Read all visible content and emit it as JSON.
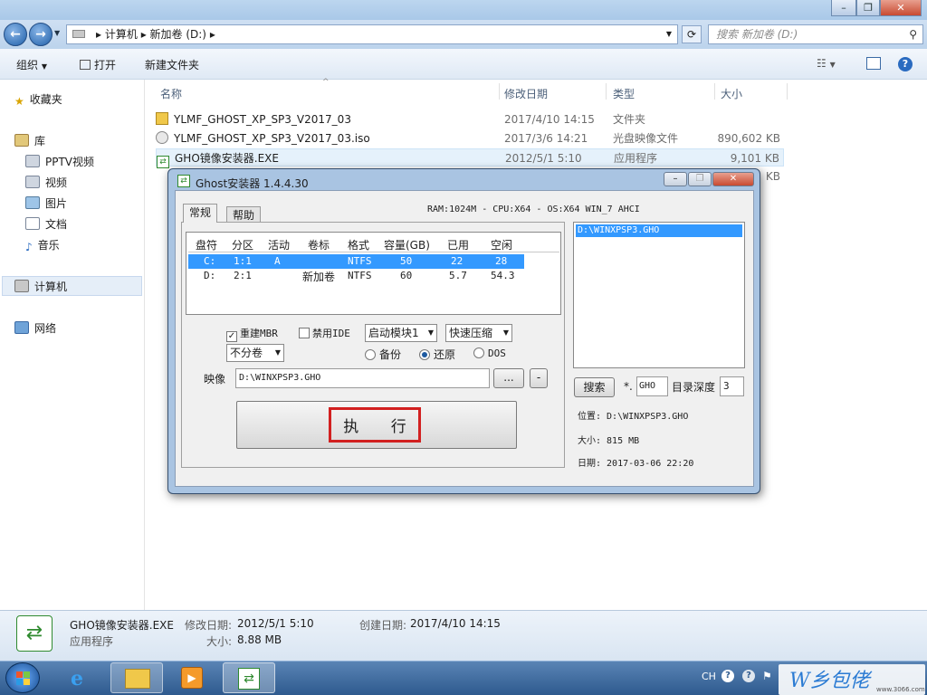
{
  "explorer": {
    "breadcrumb": [
      "计算机",
      "新加卷 (D:)"
    ],
    "search_placeholder": "搜索 新加卷 (D:)",
    "toolbar": {
      "organize": "组织",
      "open": "打开",
      "new_folder": "新建文件夹"
    },
    "nav": {
      "favorites": "收藏夹",
      "libraries": "库",
      "lib_items": [
        "PPTV视频",
        "视频",
        "图片",
        "文档",
        "音乐"
      ],
      "computer": "计算机",
      "network": "网络"
    },
    "columns": [
      "名称",
      "修改日期",
      "类型",
      "大小"
    ],
    "files": [
      {
        "name": "YLMF_GHOST_XP_SP3_V2017_03",
        "date": "2017/4/10 14:15",
        "type": "文件夹",
        "size": ""
      },
      {
        "name": "YLMF_GHOST_XP_SP3_V2017_03.iso",
        "date": "2017/3/6 14:21",
        "type": "光盘映像文件",
        "size": "890,602 KB"
      },
      {
        "name": "GHO镜像安装器.EXE",
        "date": "2012/5/1 5:10",
        "type": "应用程序",
        "size": "9,101 KB"
      },
      {
        "name": "",
        "date": "",
        "type": "",
        "size": "KB"
      }
    ],
    "details": {
      "name": "GHO镜像安装器.EXE",
      "modified_label": "修改日期:",
      "modified": "2012/5/1 5:10",
      "created_label": "创建日期:",
      "created": "2017/4/10 14:15",
      "kind": "应用程序",
      "size_label": "大小:",
      "size": "8.88 MB"
    }
  },
  "dialog": {
    "title": "Ghost安装器 1.4.4.30",
    "sysinfo": "RAM:1024M - CPU:X64 - OS:X64 WIN_7 AHCI",
    "tabs": [
      "常规",
      "帮助"
    ],
    "grid_headers": [
      "盘符",
      "分区",
      "活动",
      "卷标",
      "格式",
      "容量(GB)",
      "已用",
      "空闲"
    ],
    "grid_rows": [
      [
        "C:",
        "1:1",
        "A",
        "",
        "NTFS",
        "50",
        "22",
        "28"
      ],
      [
        "D:",
        "2:1",
        "",
        "新加卷",
        "NTFS",
        "60",
        "5.7",
        "54.3"
      ]
    ],
    "opt_rebuild_mbr": "重建MBR",
    "opt_disable_ide": "禁用IDE",
    "boot_module": "启动模块1",
    "compress": "快速压缩",
    "split": "不分卷",
    "radio_backup": "备份",
    "radio_restore": "还原",
    "radio_dos": "DOS",
    "image_label": "映像",
    "image_path": "D:\\WINXPSP3.GHO",
    "browse": "...",
    "minus": "-",
    "execute": "执 行",
    "list_item": "D:\\WINXPSP3.GHO",
    "search_btn": "搜索",
    "ext_prefix": "*.",
    "ext": "GHO",
    "depth_label": "目录深度",
    "depth": "3",
    "location": "位置: D:\\WINXPSP3.GHO",
    "size": "大小: 815 MB",
    "date": "日期: 2017-03-06  22:20"
  },
  "taskbar": {
    "lang": "CH",
    "watermark": "W乡包佬",
    "watermark_url": "www.3066.com"
  }
}
